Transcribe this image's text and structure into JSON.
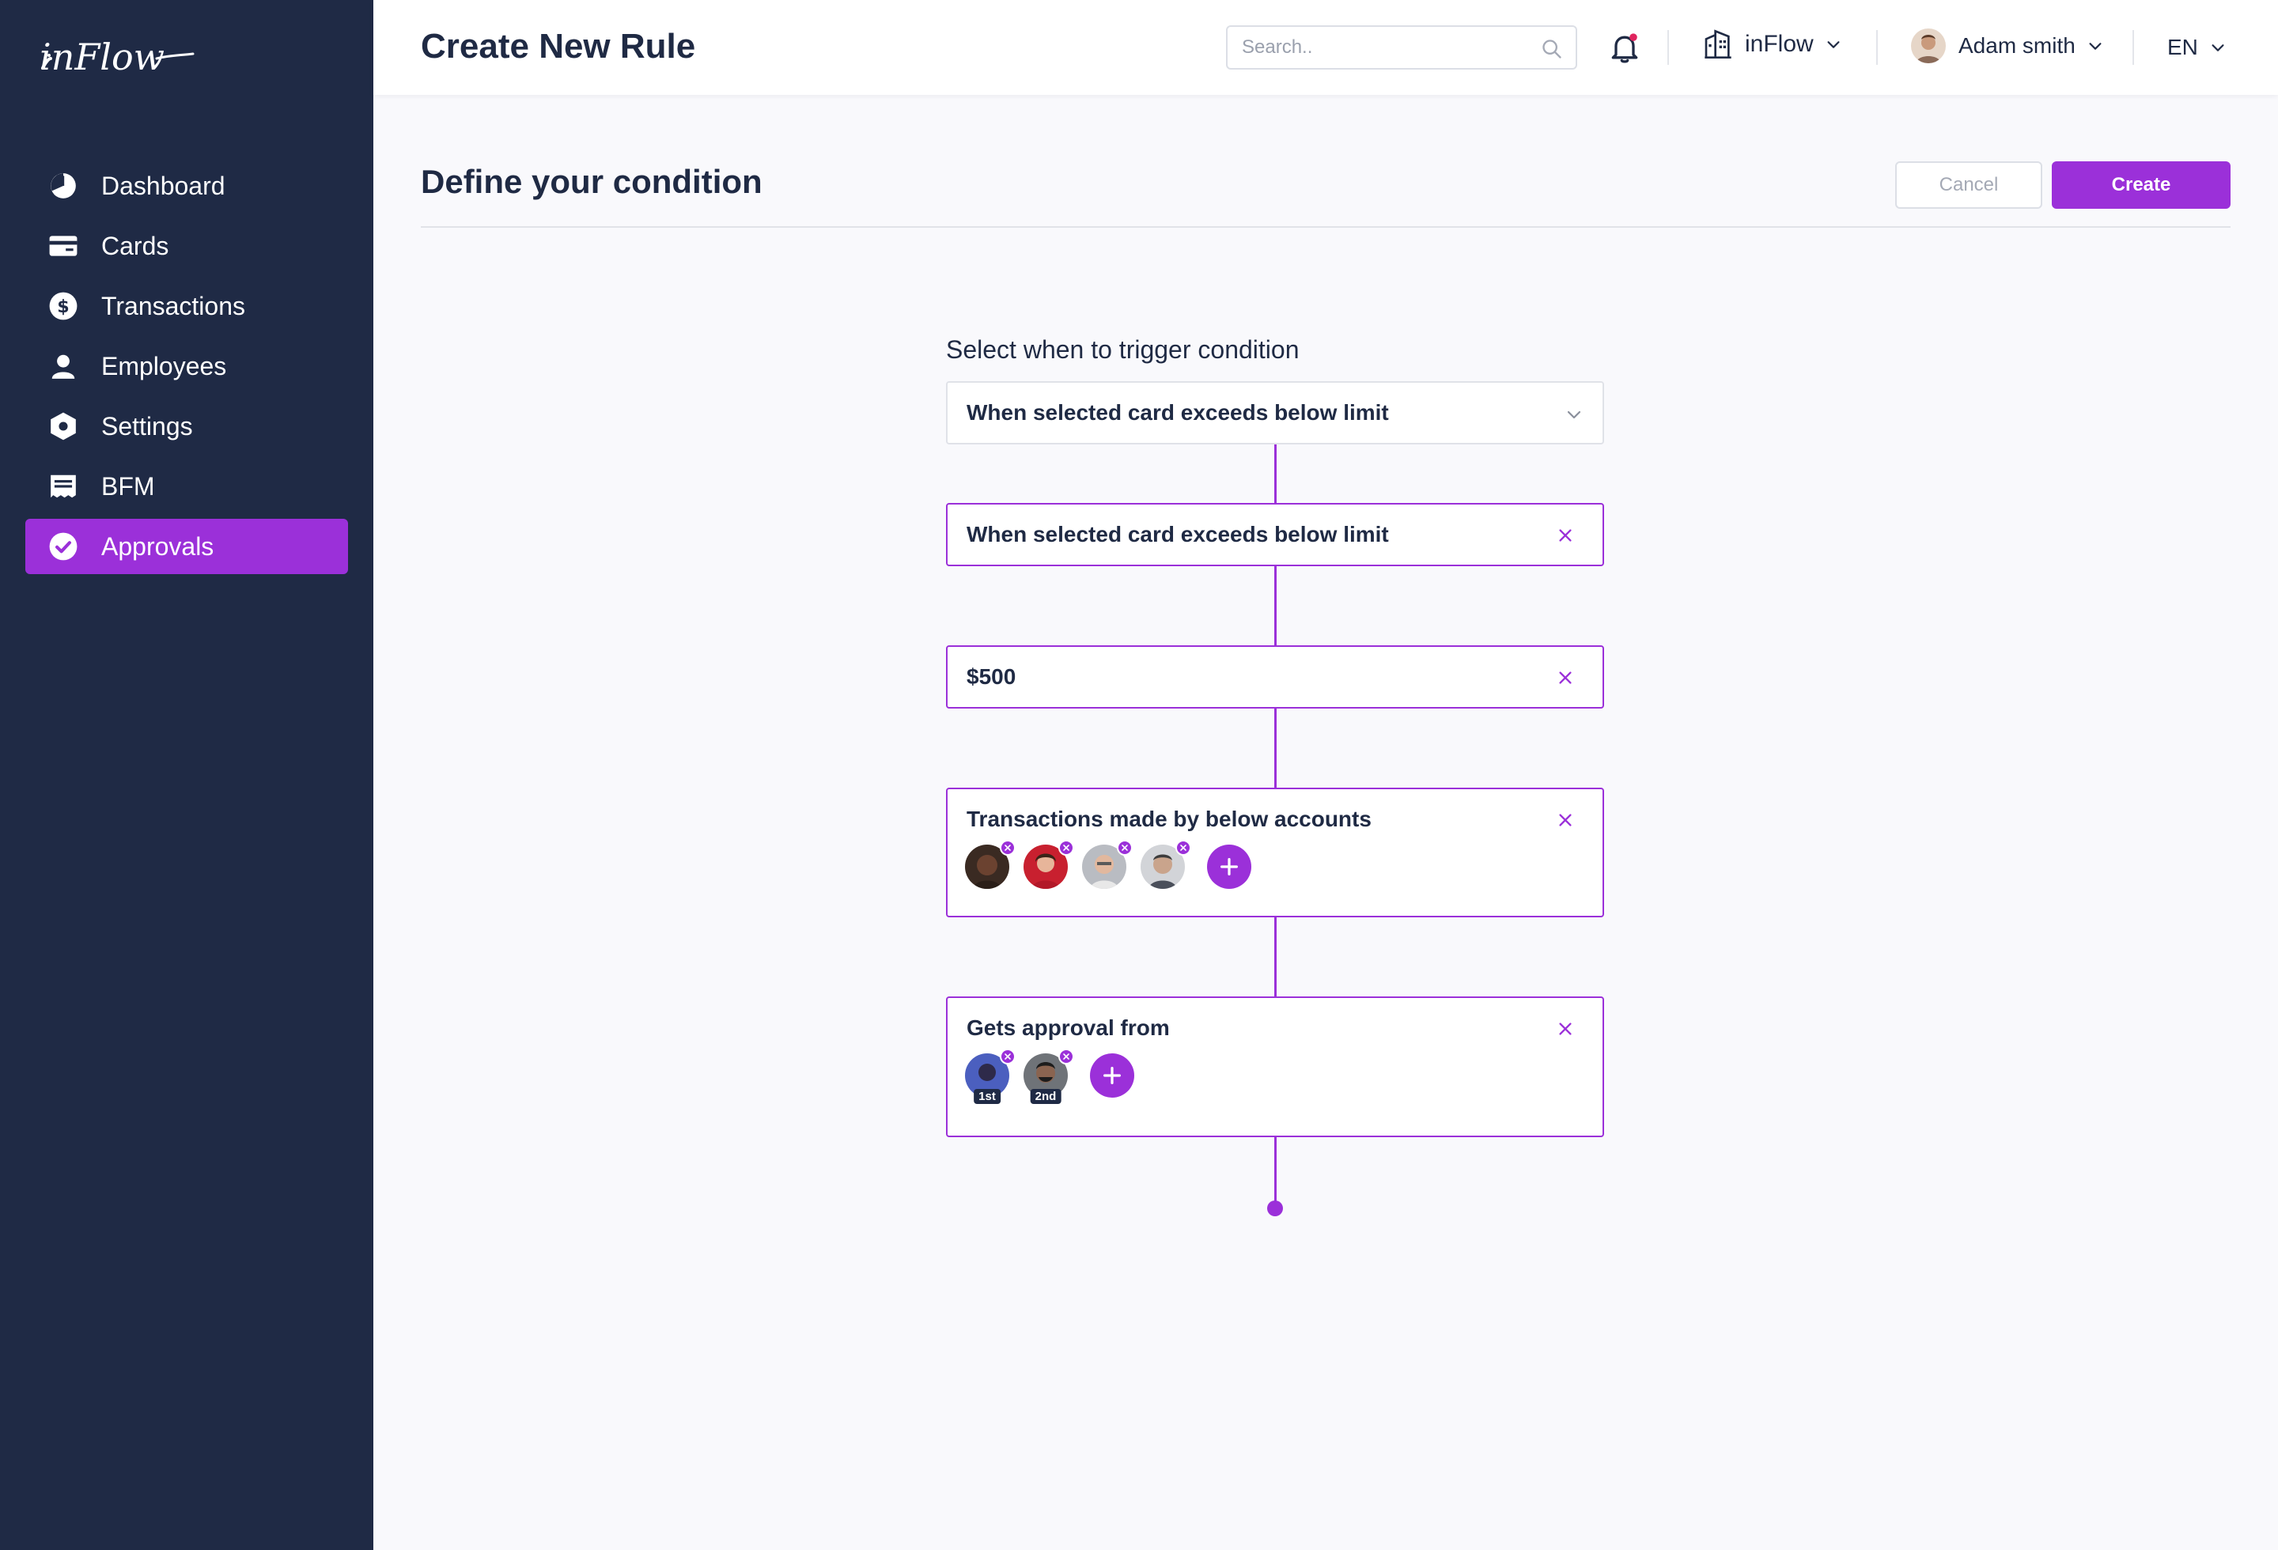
{
  "app": {
    "logo_text": "inFlow"
  },
  "sidebar": {
    "items": [
      {
        "label": "Dashboard",
        "icon": "pie-chart-icon",
        "active": false
      },
      {
        "label": "Cards",
        "icon": "card-icon",
        "active": false
      },
      {
        "label": "Transactions",
        "icon": "dollar-icon",
        "active": false
      },
      {
        "label": "Employees",
        "icon": "person-icon",
        "active": false
      },
      {
        "label": "Settings",
        "icon": "hexagon-gear-icon",
        "active": false
      },
      {
        "label": "BFM",
        "icon": "receipt-icon",
        "active": false
      },
      {
        "label": "Approvals",
        "icon": "check-circle-icon",
        "active": true
      }
    ]
  },
  "header": {
    "title": "Create New Rule",
    "search_placeholder": "Search..",
    "org_name": "inFlow",
    "user_name": "Adam smith",
    "language": "EN"
  },
  "main": {
    "section_title": "Define your condition",
    "cancel_label": "Cancel",
    "create_label": "Create",
    "trigger_label": "Select when to trigger condition",
    "trigger_selected": "When selected card exceeds below limit",
    "condition": "When selected card exceeds below limit",
    "amount": "$500",
    "accounts_title": "Transactions made by below accounts",
    "approval_title": "Gets approval from",
    "approver_ranks": [
      "1st",
      "2nd"
    ]
  },
  "colors": {
    "accent": "#9b30d9",
    "sidebar_bg": "#1f2a45",
    "page_bg": "#f9f9fc",
    "text_dark": "#1f2a44"
  }
}
